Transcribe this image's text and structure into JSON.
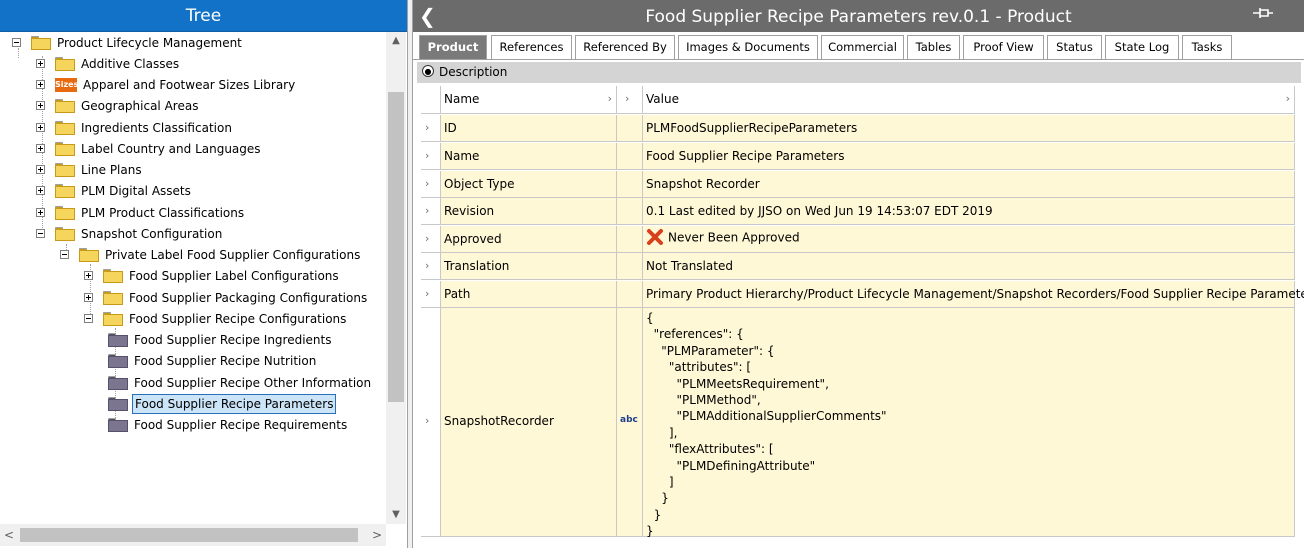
{
  "left_panel": {
    "title": "Tree",
    "tree": [
      {
        "label": "Product Lifecycle Management",
        "expander": "minus",
        "icon": "folder"
      },
      {
        "label": "Additive Classes",
        "expander": "plus",
        "icon": "folder"
      },
      {
        "label": "Apparel and Footwear Sizes Library",
        "expander": "plus",
        "icon": "sizes-icon",
        "icon_text": "Sizes"
      },
      {
        "label": "Geographical Areas",
        "expander": "plus",
        "icon": "folder"
      },
      {
        "label": "Ingredients Classification",
        "expander": "plus",
        "icon": "folder"
      },
      {
        "label": "Label Country and Languages",
        "expander": "plus",
        "icon": "folder"
      },
      {
        "label": "Line Plans",
        "expander": "plus",
        "icon": "folder"
      },
      {
        "label": "PLM Digital Assets",
        "expander": "plus",
        "icon": "folder"
      },
      {
        "label": "PLM Product Classifications",
        "expander": "plus",
        "icon": "folder"
      },
      {
        "label": "Snapshot Configuration",
        "expander": "minus",
        "icon": "folder"
      },
      {
        "label": "Private Label Food Supplier Configurations",
        "expander": "minus",
        "icon": "folder"
      },
      {
        "label": "Food Supplier Label Configurations",
        "expander": "plus",
        "icon": "folder"
      },
      {
        "label": "Food Supplier Packaging Configurations",
        "expander": "plus",
        "icon": "folder"
      },
      {
        "label": "Food Supplier Recipe Configurations",
        "expander": "minus",
        "icon": "folder"
      },
      {
        "label": "Food Supplier Recipe Ingredients",
        "icon": "dark-folder"
      },
      {
        "label": "Food Supplier Recipe Nutrition",
        "icon": "dark-folder"
      },
      {
        "label": "Food Supplier Recipe Other Information",
        "icon": "dark-folder"
      },
      {
        "label": "Food Supplier Recipe Parameters",
        "icon": "dark-folder",
        "selected": true
      },
      {
        "label": "Food Supplier Recipe Requirements",
        "icon": "dark-folder"
      }
    ]
  },
  "right_panel": {
    "title": "Food Supplier Recipe Parameters rev.0.1 - Product",
    "back_icon": "chevron-left-icon",
    "pin_icon": "pin-icon",
    "tabs": [
      {
        "label": "Product",
        "active": true
      },
      {
        "label": "References"
      },
      {
        "label": "Referenced By"
      },
      {
        "label": "Images & Documents"
      },
      {
        "label": "Commercial"
      },
      {
        "label": "Tables"
      },
      {
        "label": "Proof View"
      },
      {
        "label": "Status"
      },
      {
        "label": "State Log"
      },
      {
        "label": "Tasks"
      }
    ],
    "description_label": "Description",
    "grid": {
      "col_name": "Name",
      "col_value": "Value",
      "rows": [
        {
          "name": "ID",
          "value": "PLMFoodSupplierRecipeParameters"
        },
        {
          "name": "Name",
          "value": "Food Supplier Recipe Parameters"
        },
        {
          "name": "Object Type",
          "value": "Snapshot Recorder"
        },
        {
          "name": "Revision",
          "value": "0.1 Last edited by JJSO on Wed Jun 19 14:53:07 EDT 2019"
        },
        {
          "name": "Approved",
          "value": "Never Been Approved",
          "icon": "not-approved-x-icon"
        },
        {
          "name": "Translation",
          "value": "Not Translated"
        },
        {
          "name": "Path",
          "value": "Primary Product Hierarchy/Product Lifecycle Management/Snapshot Recorders/Food Supplier Recipe Parameters"
        },
        {
          "name": "SnapshotRecorder",
          "type_badge": "abc",
          "value": "{\n  \"references\": {\n    \"PLMParameter\": {\n      \"attributes\": [\n        \"PLMMeetsRequirement\",\n        \"PLMMethod\",\n        \"PLMAdditionalSupplierComments\"\n      ],\n      \"flexAttributes\": [\n        \"PLMDefiningAttribute\"\n      ]\n    }\n  }\n}"
        }
      ]
    }
  }
}
